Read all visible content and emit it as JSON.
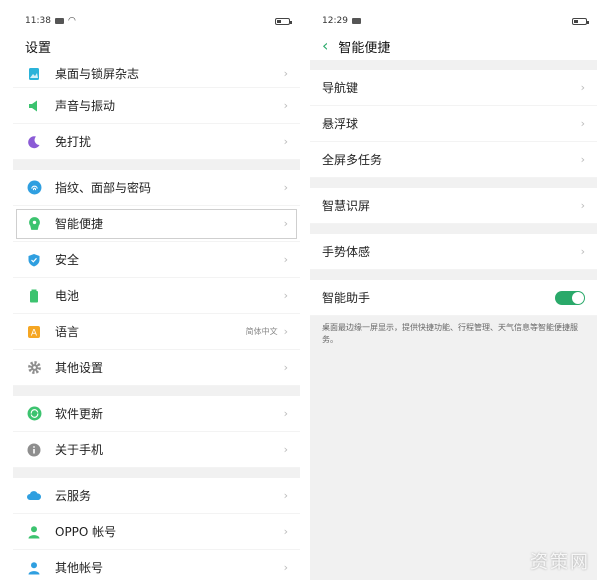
{
  "left": {
    "status": {
      "time": "11:38"
    },
    "title": "设置",
    "groups": [
      [
        {
          "label": "桌面与锁屏杂志",
          "icon": "wallpaper-icon"
        },
        {
          "label": "声音与振动",
          "icon": "speaker-icon"
        },
        {
          "label": "免打扰",
          "icon": "moon-icon"
        }
      ],
      [
        {
          "label": "指纹、面部与密码",
          "icon": "fingerprint-icon"
        },
        {
          "label": "智能便捷",
          "icon": "smart-assist-icon"
        },
        {
          "label": "安全",
          "icon": "shield-icon"
        },
        {
          "label": "电池",
          "icon": "battery-icon"
        },
        {
          "label": "语言",
          "icon": "language-icon",
          "value": "简体中文"
        },
        {
          "label": "其他设置",
          "icon": "gear-icon"
        }
      ],
      [
        {
          "label": "软件更新",
          "icon": "update-icon"
        },
        {
          "label": "关于手机",
          "icon": "info-icon"
        }
      ],
      [
        {
          "label": "云服务",
          "icon": "cloud-icon"
        },
        {
          "label": "OPPO 帐号",
          "icon": "user-icon"
        },
        {
          "label": "其他帐号",
          "icon": "user-icon"
        }
      ]
    ]
  },
  "right": {
    "status": {
      "time": "12:29"
    },
    "title": "智能便捷",
    "items": {
      "nav_key": "导航键",
      "float_ball": "悬浮球",
      "multitask": "全屏多任务",
      "smart_screen": "智慧识屏",
      "gesture": "手势体感",
      "assistant": "智能助手"
    },
    "assistant_enabled": true,
    "assistant_desc": "桌面最边缘一屏显示，提供快捷功能、行程管理、天气信息等智能便捷服务。"
  },
  "watermark": "资策网",
  "colors": {
    "accent": "#2aa96a"
  }
}
